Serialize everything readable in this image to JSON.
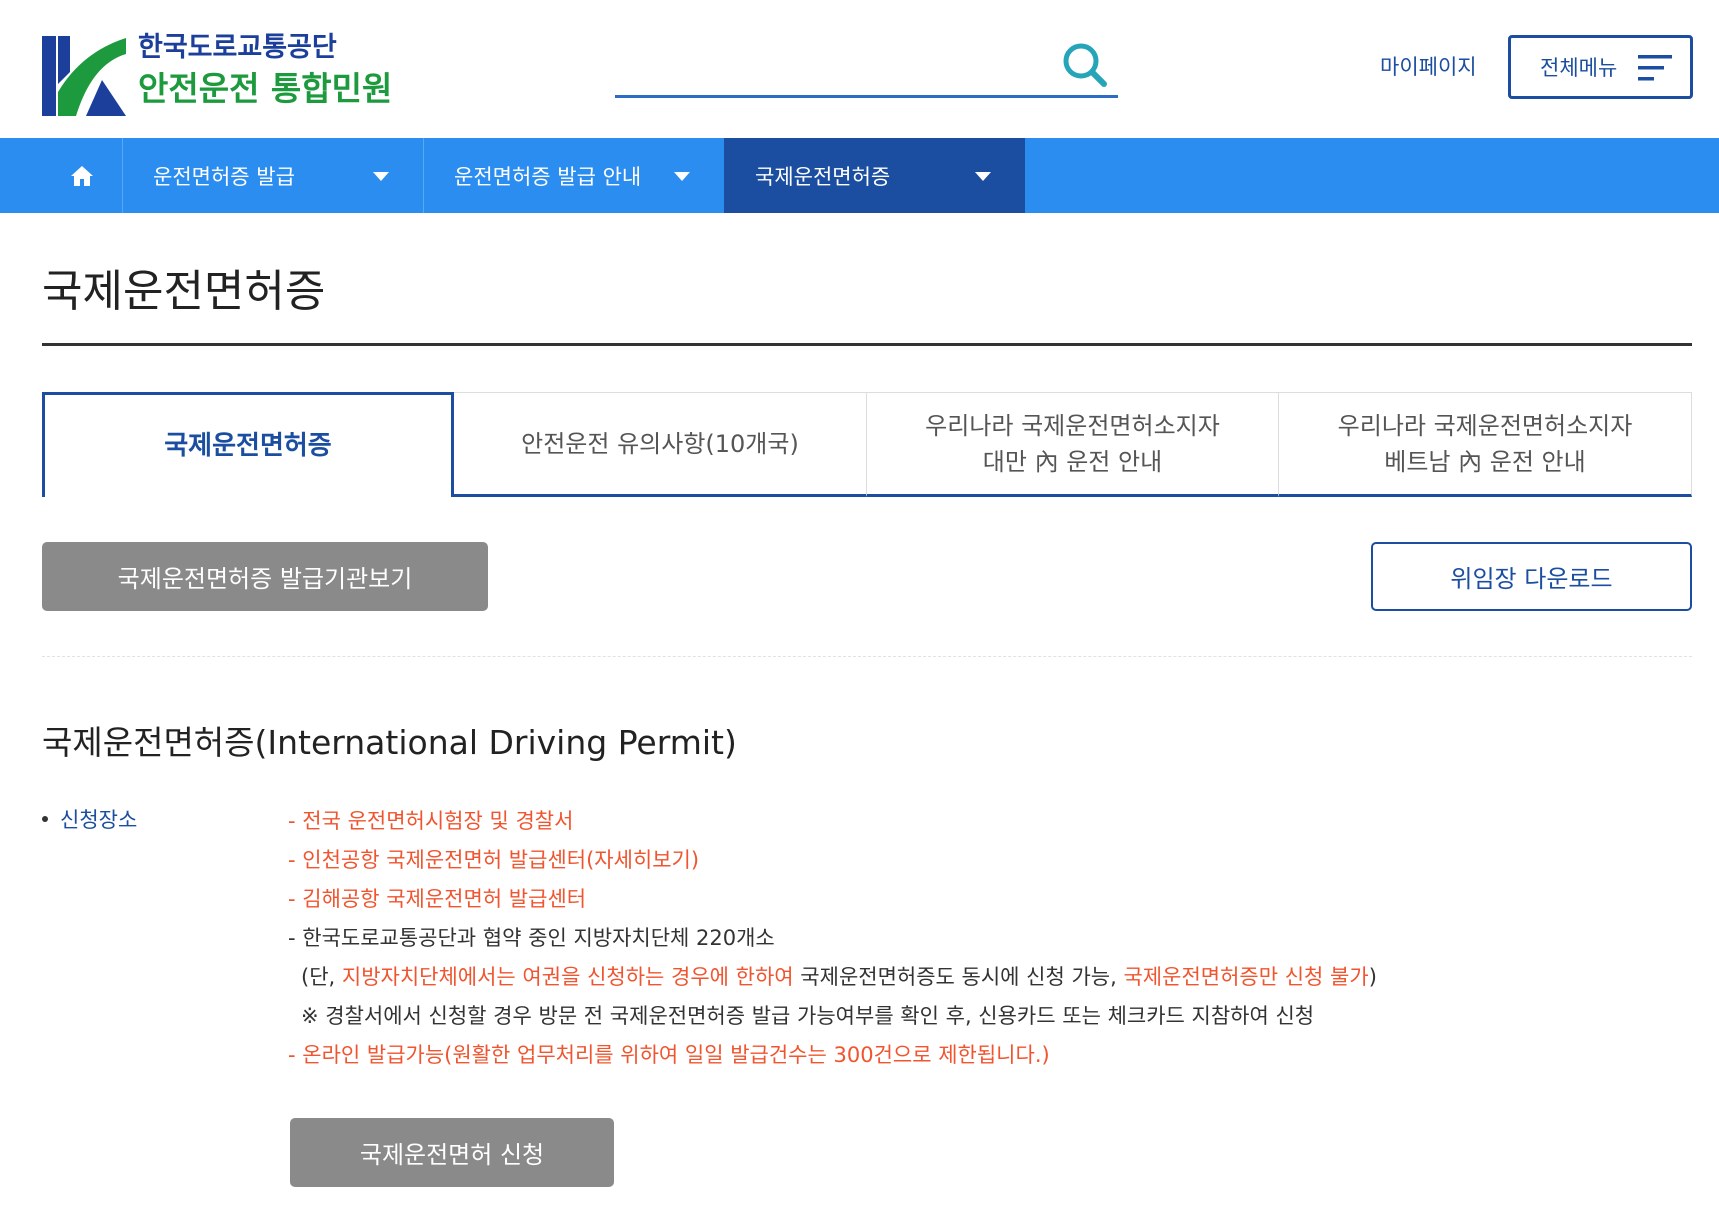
{
  "header": {
    "logo": {
      "line1": "한국도로교통공단",
      "line2": "안전운전 통합민원",
      "colors": {
        "blue": "#1b3f9a",
        "green": "#1c9a3d"
      }
    },
    "search": {
      "placeholder": "",
      "icon": "search-icon"
    },
    "mypage_label": "마이페이지",
    "allmenu_label": "전체메뉴"
  },
  "nav": {
    "home_icon": "home-icon",
    "items": [
      {
        "label": "운전면허증 발급",
        "active": false
      },
      {
        "label": "운전면허증 발급 안내",
        "active": false
      },
      {
        "label": "국제운전면허증",
        "active": true
      }
    ],
    "colors": {
      "bar": "#2b8df0",
      "active": "#1b4ea0"
    }
  },
  "page": {
    "title": "국제운전면허증"
  },
  "tabs": [
    {
      "line1": "국제운전면허증",
      "line2": "",
      "active": true
    },
    {
      "line1": "안전운전 유의사항(10개국)",
      "line2": "",
      "active": false
    },
    {
      "line1": "우리나라 국제운전면허소지자",
      "line2": "대만 內 운전 안내",
      "active": false
    },
    {
      "line1": "우리나라 국제운전면허소지자",
      "line2": "베트남 內 운전 안내",
      "active": false
    }
  ],
  "actions": {
    "issuer_button": "국제운전면허증 발급기관보기",
    "download_button": "위임장 다운로드"
  },
  "section": {
    "title": "국제운전면허증(International Driving Permit)",
    "label": "신청장소",
    "lines": {
      "l1": "- 전국 운전면허시험장 및 경찰서",
      "l2": "- 인천공항 국제운전면허 발급센터(자세히보기)",
      "l3": "- 김해공항 국제운전면허 발급센터",
      "l4": "- 한국도로교통공단과 협약 중인 지방자치단체 220개소",
      "l5a": "(단, ",
      "l5b": "지방자치단체에서는 여권을 신청하는 경우에 한하여",
      "l5c": " 국제운전면허증도 동시에 신청 가능, ",
      "l5d": "국제운전면허증만 신청 불가",
      "l5e": ")",
      "l6": "※ 경찰서에서 신청할 경우 방문 전 국제운전면허증 발급 가능여부를 확인 후, 신용카드 또는 체크카드 지참하여 신청",
      "l7": "- 온라인 발급가능(원활한 업무처리를 위하여 일일 발급건수는 300건으로 제한됩니다.)"
    },
    "apply_button": "국제운전면허 신청",
    "colors": {
      "highlight": "#f0552f",
      "label": "#1b4ea0"
    }
  }
}
